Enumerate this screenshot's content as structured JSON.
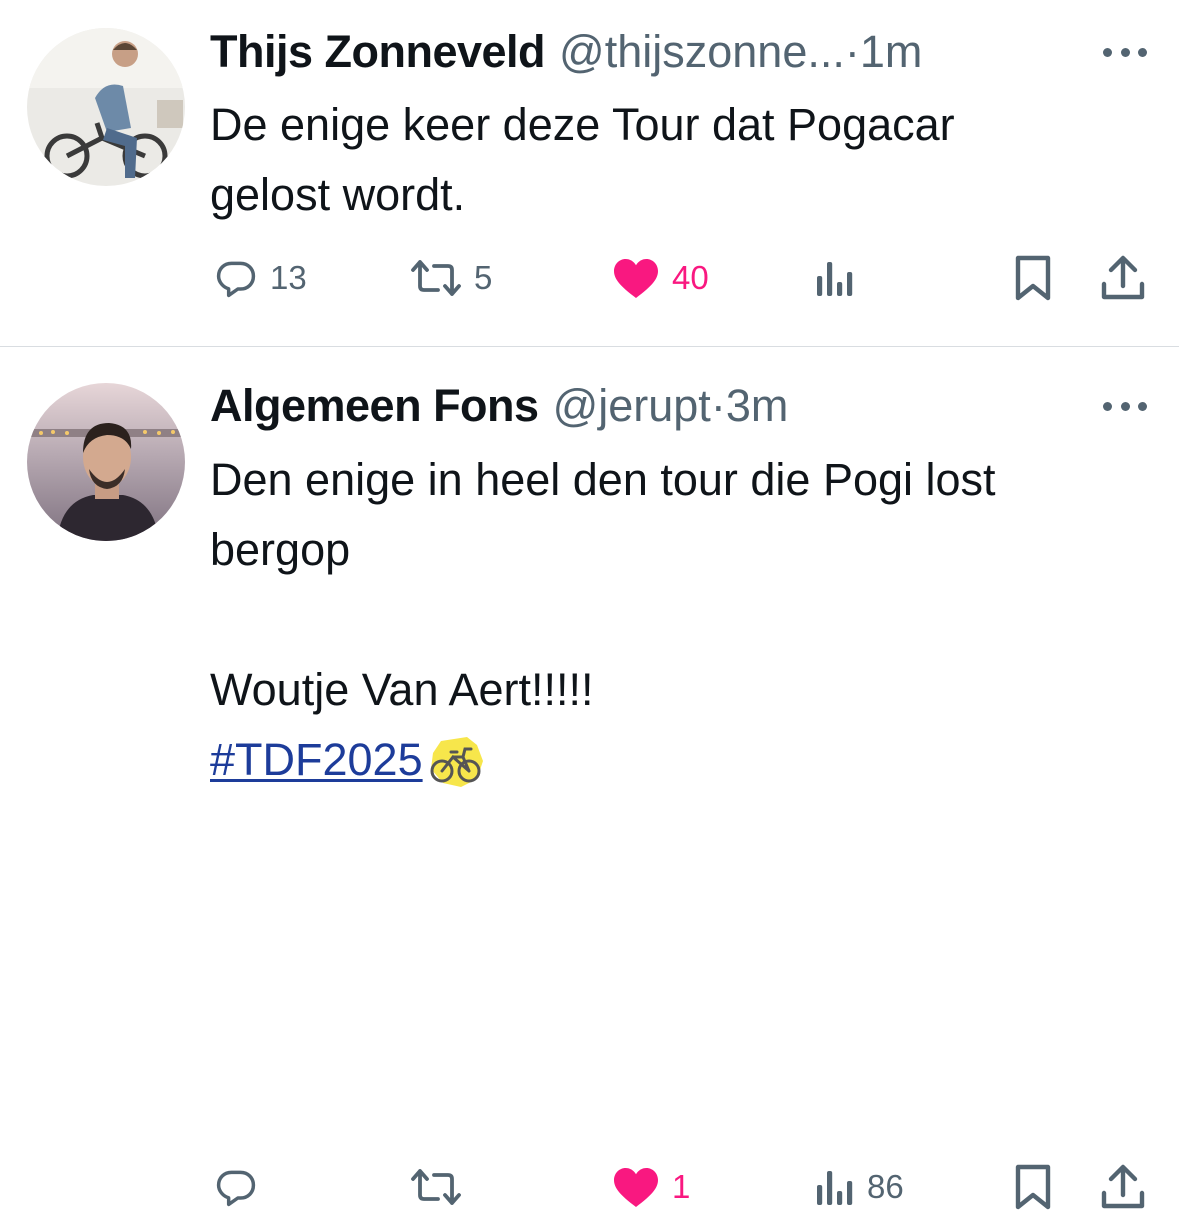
{
  "tweets": [
    {
      "name": "Thijs Zonneveld",
      "handle": "@thijszonne...",
      "dot": "·",
      "time": "1m",
      "text": "De enige keer deze Tour dat Pogacar\ngelost wordt.",
      "hashtag": "",
      "replies": "13",
      "retweets": "5",
      "likes": "40",
      "views": "",
      "liked": true
    },
    {
      "name": "Algemeen Fons",
      "handle": "@jerupt",
      "dot": "·",
      "time": "3m",
      "text": "Den enige in heel den tour die Pogi lost\nbergop\n\nWoutje Van Aert!!!!!",
      "hashtag": "#TDF2025",
      "replies": "",
      "retweets": "",
      "likes": "1",
      "views": "86",
      "liked": true
    }
  ],
  "icons": {
    "reply": "reply-icon",
    "retweet": "retweet-icon",
    "like": "heart-icon",
    "views": "views-icon",
    "bookmark": "bookmark-icon",
    "share": "share-icon",
    "more": "more-icon",
    "emoji": "bicycle-emoji"
  },
  "colors": {
    "text": "#0f1419",
    "secondary": "#536471",
    "like": "#f91880",
    "link": "#1d3c9a",
    "divider": "#d9dde1"
  }
}
